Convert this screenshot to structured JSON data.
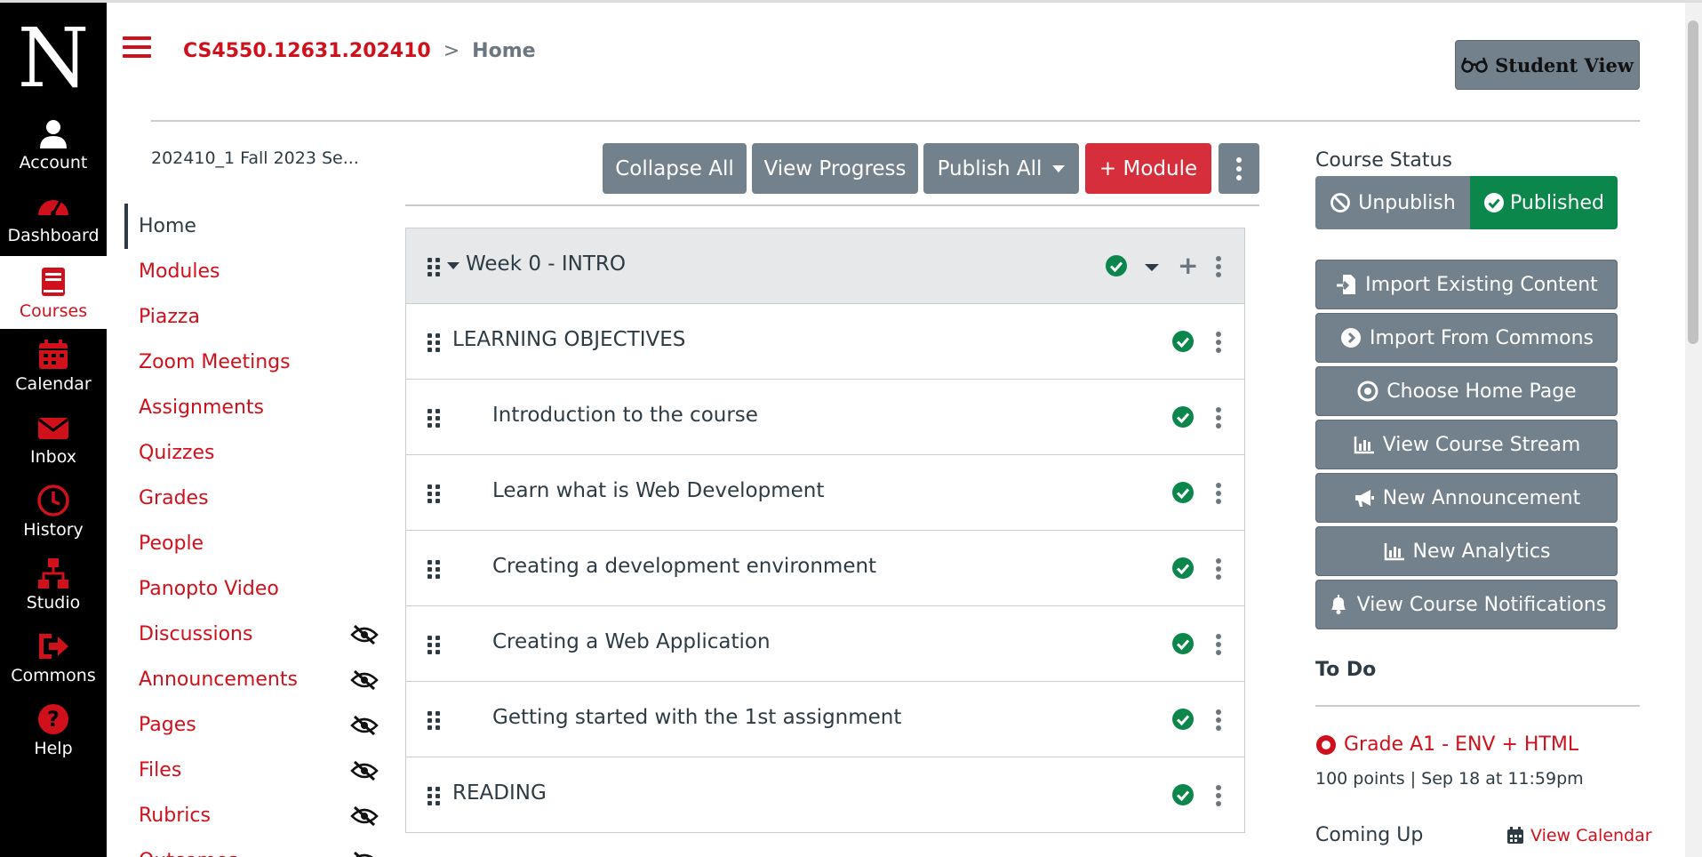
{
  "global_nav": {
    "logo": "N",
    "items": [
      {
        "label": "Account",
        "icon": "user-icon"
      },
      {
        "label": "Dashboard",
        "icon": "speedometer-icon"
      },
      {
        "label": "Courses",
        "icon": "book-icon",
        "active": true
      },
      {
        "label": "Calendar",
        "icon": "calendar-icon"
      },
      {
        "label": "Inbox",
        "icon": "envelope-icon"
      },
      {
        "label": "History",
        "icon": "clock-icon"
      },
      {
        "label": "Studio",
        "icon": "network-icon"
      },
      {
        "label": "Commons",
        "icon": "share-icon"
      },
      {
        "label": "Help",
        "icon": "question-icon"
      }
    ]
  },
  "header": {
    "course_code": "CS4550.12631.202410",
    "separator": ">",
    "current_page": "Home",
    "student_view_label": "Student View"
  },
  "course_nav": {
    "term": "202410_1 Fall 2023 Se...",
    "items": [
      {
        "label": "Home",
        "active": true,
        "hidden": false
      },
      {
        "label": "Modules",
        "hidden": false
      },
      {
        "label": "Piazza",
        "hidden": false
      },
      {
        "label": "Zoom Meetings",
        "hidden": false
      },
      {
        "label": "Assignments",
        "hidden": false
      },
      {
        "label": "Quizzes",
        "hidden": false
      },
      {
        "label": "Grades",
        "hidden": false
      },
      {
        "label": "People",
        "hidden": false
      },
      {
        "label": "Panopto Video",
        "hidden": false
      },
      {
        "label": "Discussions",
        "hidden": true
      },
      {
        "label": "Announcements",
        "hidden": true
      },
      {
        "label": "Pages",
        "hidden": true
      },
      {
        "label": "Files",
        "hidden": true
      },
      {
        "label": "Rubrics",
        "hidden": true
      },
      {
        "label": "Outcomes",
        "hidden": true
      }
    ]
  },
  "toolbar": {
    "collapse_all": "Collapse All",
    "view_progress": "View Progress",
    "publish_all": "Publish All",
    "add_module": "+ Module"
  },
  "module": {
    "title": "Week 0 - INTRO",
    "items": [
      {
        "title": "LEARNING OBJECTIVES",
        "type": "header"
      },
      {
        "title": "Introduction to the course",
        "type": "indent"
      },
      {
        "title": "Learn what is Web Development",
        "type": "indent"
      },
      {
        "title": "Creating a development environment",
        "type": "indent"
      },
      {
        "title": "Creating a Web Application",
        "type": "indent"
      },
      {
        "title": "Getting started with the 1st assignment",
        "type": "indent"
      },
      {
        "title": "READING",
        "type": "header"
      }
    ]
  },
  "sidebar": {
    "status_label": "Course Status",
    "unpublish": "Unpublish",
    "published": "Published",
    "buttons": [
      {
        "label": "Import Existing Content",
        "icon": "import-icon"
      },
      {
        "label": "Import From Commons",
        "icon": "arrow-circle-icon"
      },
      {
        "label": "Choose Home Page",
        "icon": "target-icon"
      },
      {
        "label": "View Course Stream",
        "icon": "bar-chart-icon"
      },
      {
        "label": "New Announcement",
        "icon": "megaphone-icon"
      },
      {
        "label": "New Analytics",
        "icon": "bar-chart-icon"
      },
      {
        "label": "View Course Notifications",
        "icon": "bell-icon"
      }
    ],
    "todo_heading": "To Do",
    "todo_item": "Grade A1 - ENV + HTML",
    "todo_meta": "100 points | Sep 18 at 11:59pm",
    "coming_up": "Coming Up",
    "view_calendar": "View Calendar"
  },
  "colors": {
    "brand_red": "#d0101b",
    "button_gray": "#73818c",
    "published_green": "#0b874b"
  }
}
